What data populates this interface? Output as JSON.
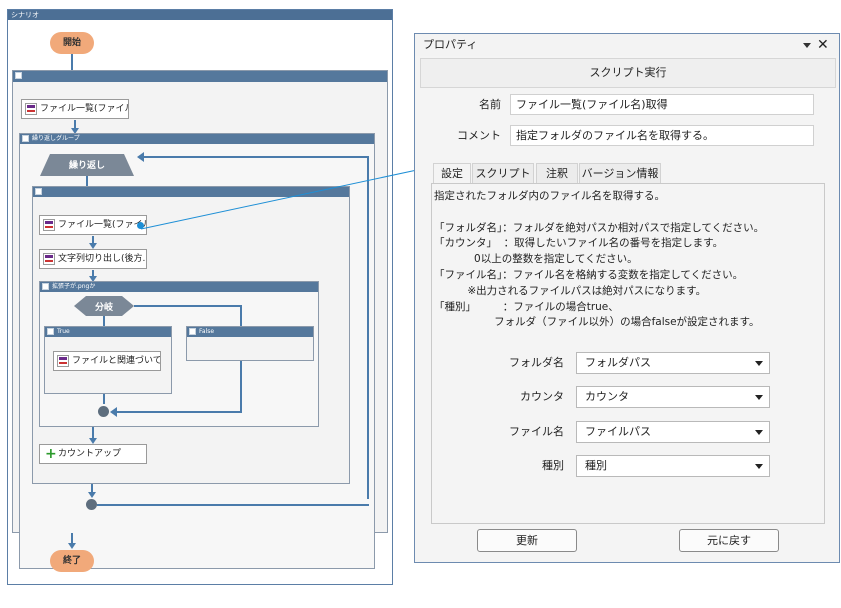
{
  "scenario": {
    "title": "シナリオ",
    "start_label": "開始",
    "end_label": "終了",
    "outer_group_title": "",
    "node_file_list_1": "ファイル一覧(ファイル数...",
    "loop_group_title": "繰り返しグループ",
    "loop_label": "繰り返し",
    "inner_group_title": "",
    "node_file_list_2": "ファイル一覧(ファイル名",
    "node_substring": "文字列切り出し(後方...",
    "condition_group_title": "拡張子が.pngか",
    "branch_label": "分岐",
    "true_title": "True",
    "false_title": "False",
    "node_related_app": "ファイルと関連づいてい...",
    "node_count_up": "カウントアップ"
  },
  "properties": {
    "title": "プロパティ",
    "header": "スクリプト実行",
    "name_label": "名前",
    "name_value": "ファイル一覧(ファイル名)取得",
    "comment_label": "コメント",
    "comment_value": "指定フォルダのファイル名を取得する。",
    "tabs": [
      "設定",
      "スクリプト",
      "注釈",
      "バージョン情報"
    ],
    "description": [
      "指定されたフォルダ内のファイル名を取得する。",
      "",
      "「フォルダ名」：フォルダを絶対パスか相対パスで指定してください。",
      "「カウンタ」  ：取得したいファイル名の番号を指定します。",
      "            0以上の整数を指定してください。",
      "「ファイル名」：ファイル名を格納する変数を指定してください。",
      "          ※出力されるファイルパスは絶対パスになります。",
      "「種別」        ：ファイルの場合true、",
      "                  フォルダ（ファイル以外）の場合falseが設定されます。"
    ],
    "fields": [
      {
        "label": "フォルダ名",
        "value": "フォルダパス"
      },
      {
        "label": "カウンタ",
        "value": "カウンタ"
      },
      {
        "label": "ファイル名",
        "value": "ファイルパス"
      },
      {
        "label": "種別",
        "value": "種別"
      }
    ],
    "update_button": "更新",
    "revert_button": "元に戻す"
  }
}
